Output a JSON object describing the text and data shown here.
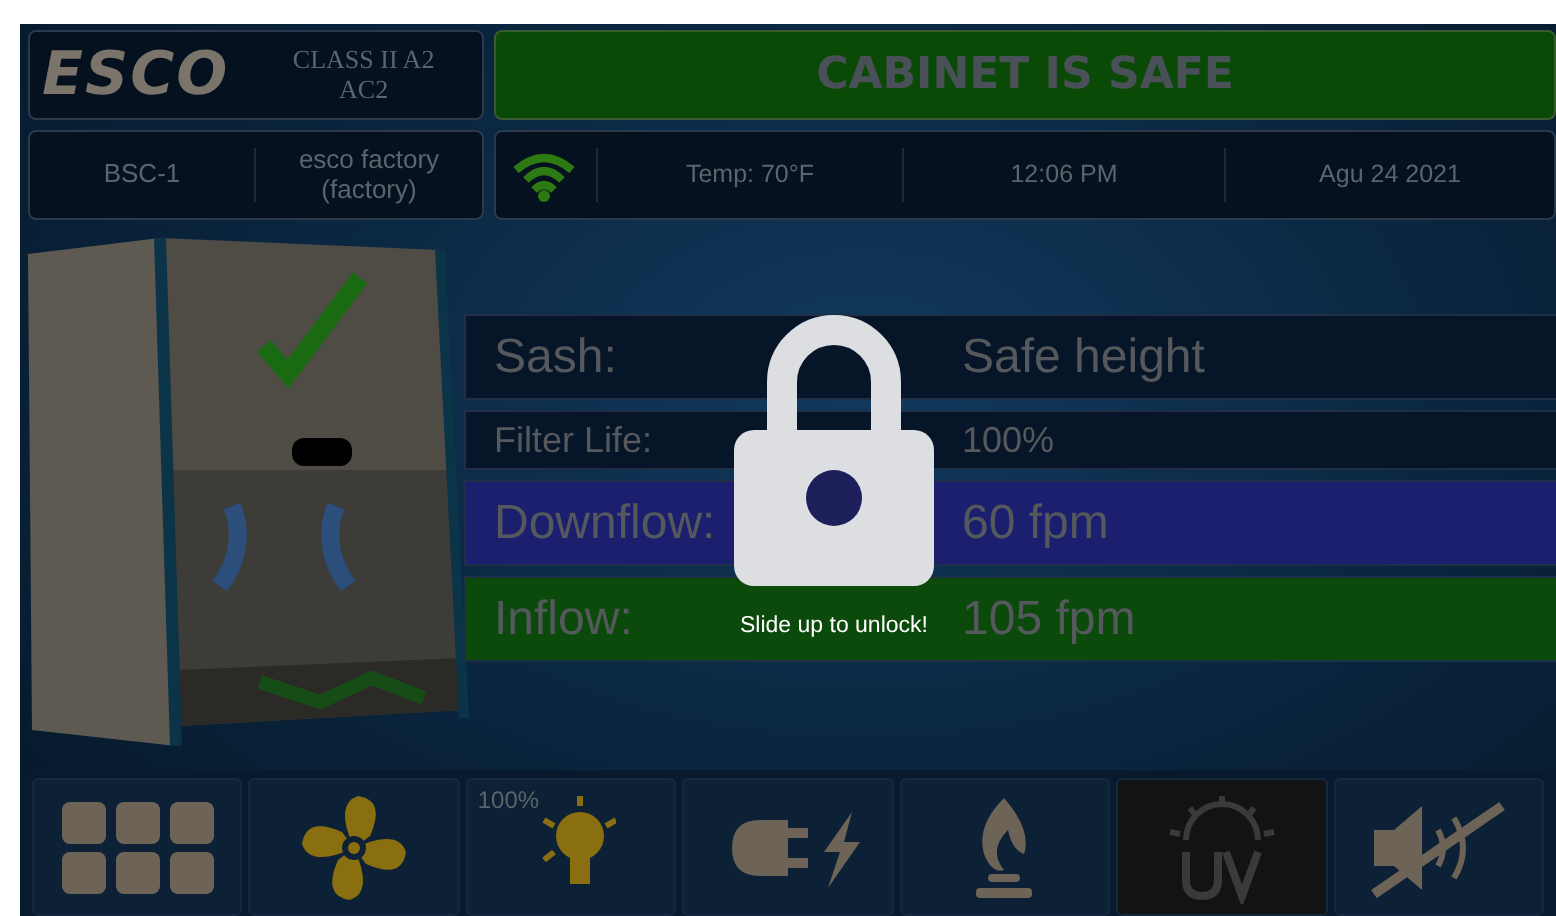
{
  "header": {
    "logo": "ESCO",
    "model": "CLASS II A2\nAC2",
    "status": "CABINET IS SAFE"
  },
  "info_bar": {
    "cabinet_id": "BSC-1",
    "user": "esco factory\n(factory)",
    "wifi_connected": true,
    "temperature": "Temp: 70°F",
    "time": "12:06 PM",
    "date": "Agu 24 2021"
  },
  "readings": [
    {
      "kind": "major",
      "label": "Sash:",
      "value": "Safe height",
      "color": "#061528"
    },
    {
      "kind": "minor",
      "label": "Filter Life:",
      "value": "100%",
      "color": "#061528"
    },
    {
      "kind": "major",
      "label": "Downflow:",
      "value": "60 fpm",
      "color": "#1c1f6e"
    },
    {
      "kind": "major",
      "label": "Inflow:",
      "value": "105 fpm",
      "color": "#0c4a0c"
    }
  ],
  "lock_overlay": {
    "message": "Slide up to unlock!"
  },
  "toolbar": [
    {
      "kind": "menu",
      "on": false,
      "disabled": false
    },
    {
      "kind": "fan",
      "on": true,
      "disabled": false
    },
    {
      "kind": "light",
      "on": true,
      "disabled": false,
      "label": "100%"
    },
    {
      "kind": "outlet",
      "on": false,
      "disabled": false
    },
    {
      "kind": "gas",
      "on": false,
      "disabled": false
    },
    {
      "kind": "uv",
      "on": false,
      "disabled": true
    },
    {
      "kind": "mute",
      "on": false,
      "disabled": false
    }
  ]
}
